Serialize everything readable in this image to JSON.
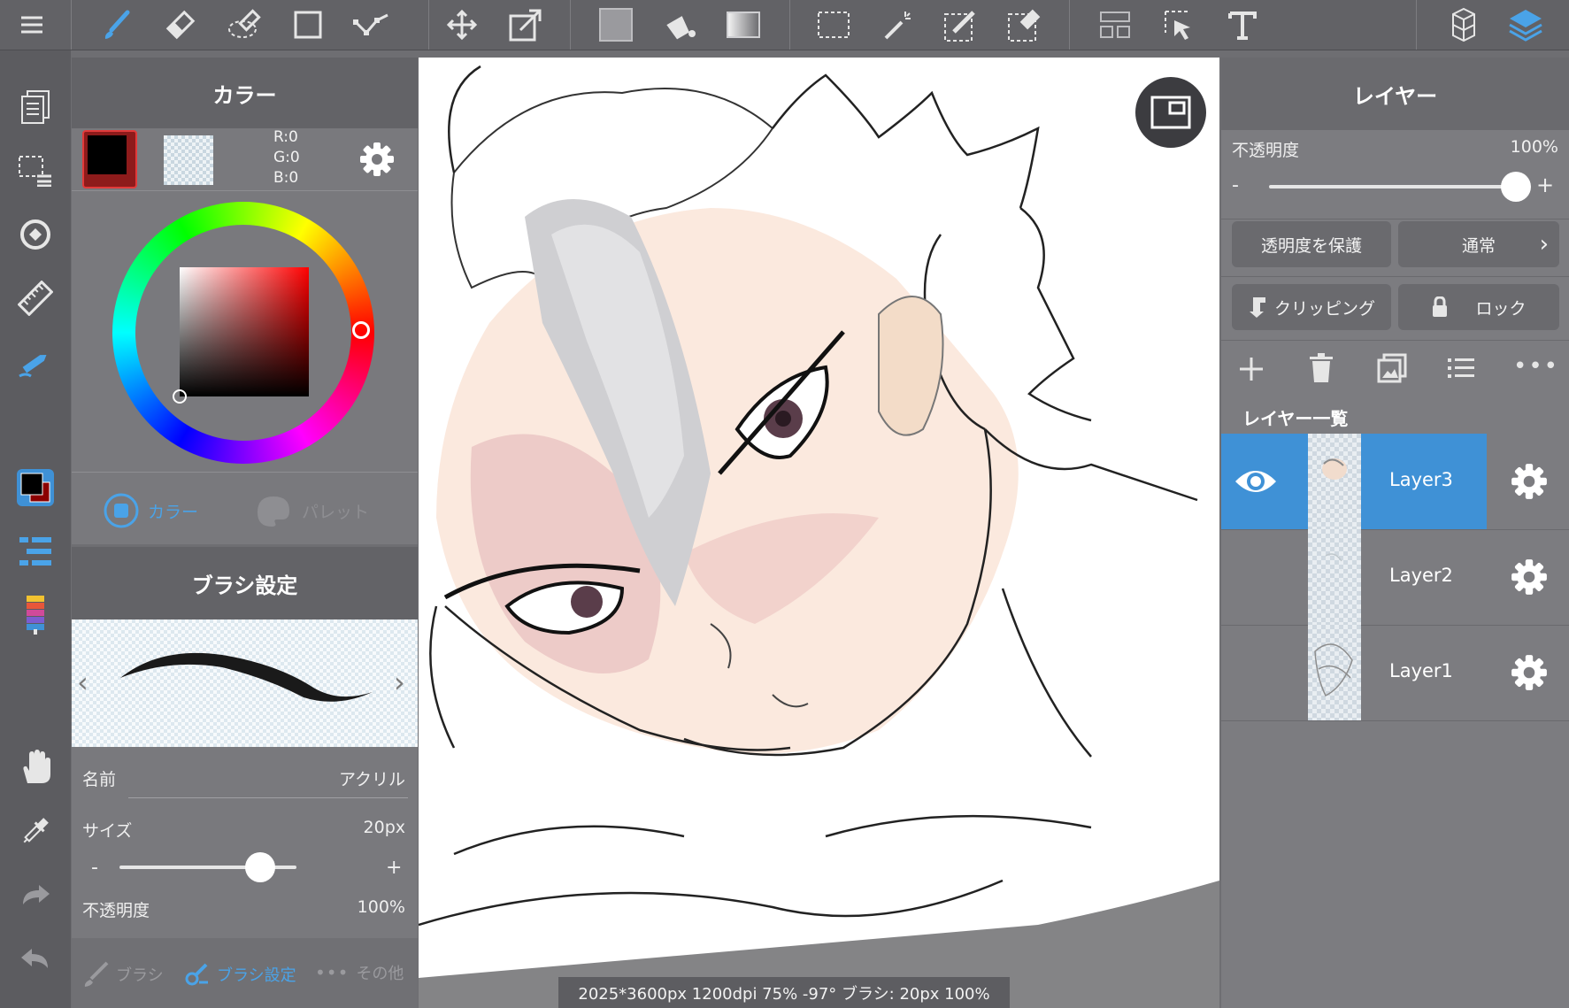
{
  "color_panel": {
    "title": "カラー",
    "rgb": {
      "r": "R:0",
      "g": "G:0",
      "b": "B:0"
    },
    "tabs": [
      "カラー",
      "パレット"
    ]
  },
  "brush_panel": {
    "title": "ブラシ設定",
    "name_label": "名前",
    "name_value": "アクリル",
    "size_label": "サイズ",
    "size_value": "20px",
    "opacity_label": "不透明度",
    "opacity_value": "100%",
    "minus": "-",
    "plus": "+",
    "bottom_tabs": [
      "ブラシ",
      "ブラシ設定",
      "その他"
    ]
  },
  "layer_panel": {
    "title": "レイヤー",
    "opacity_label": "不透明度",
    "opacity_value": "100%",
    "opacity_fraction": 1.0,
    "minus": "-",
    "plus": "+",
    "protect_alpha": "透明度を保護",
    "blend_mode": "通常",
    "clipping": "クリッピング",
    "lock": "ロック",
    "list_title": "レイヤー一覧",
    "layers": [
      {
        "name": "Layer3",
        "selected": true,
        "visible": true
      },
      {
        "name": "Layer2",
        "selected": false,
        "visible": false
      },
      {
        "name": "Layer1",
        "selected": false,
        "visible": false
      }
    ]
  },
  "brush_size_fraction": 0.8,
  "status_bar": "2025*3600px 1200dpi 75% -97° ブラシ: 20px 100%",
  "colors": {
    "accent": "#3f91d6",
    "primary_color": "#000000",
    "active_tool": "#4aa3e8"
  },
  "toolbar_icons": [
    "menu-icon",
    "brush-icon",
    "eraser-icon",
    "lasso-eraser-icon",
    "rectangle-icon",
    "polyline-icon",
    "move-icon",
    "transform-icon",
    "fill-color-icon",
    "bucket-icon",
    "gradient-icon",
    "select-rect-icon",
    "magic-wand-icon",
    "select-pen-icon",
    "select-eraser-icon",
    "layout-icon",
    "select-move-icon",
    "text-icon",
    "3d-icon",
    "layers-icon"
  ]
}
